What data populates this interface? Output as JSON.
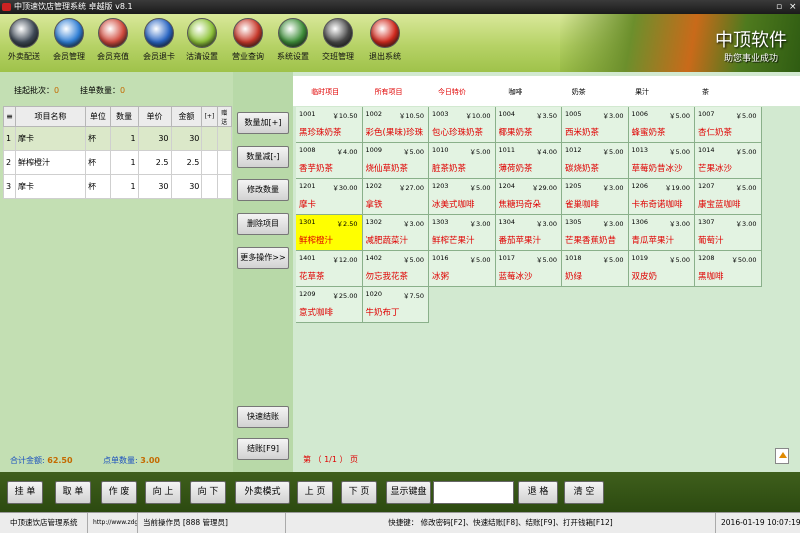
{
  "window": {
    "title": "中顶速饮店管理系统 卓越版 v8.1",
    "controls": [
      "▫",
      "×"
    ]
  },
  "toolbar": {
    "items": [
      {
        "label": "外卖配送",
        "icon": "delivery-icon",
        "color": "#3f4a57"
      },
      {
        "label": "会员管理",
        "icon": "member-icon",
        "color": "#2f7fd6"
      },
      {
        "label": "会员充值",
        "icon": "recharge-icon",
        "color": "#d24b3e"
      },
      {
        "label": "会员退卡",
        "icon": "card-icon",
        "color": "#2a66c4"
      },
      {
        "label": "沽清设置",
        "icon": "dish-icon",
        "color": "#8fc43a"
      },
      {
        "label": "营业查询",
        "icon": "search-icon",
        "color": "#c93a2c"
      },
      {
        "label": "系统设置",
        "icon": "gear-icon",
        "color": "#3f8f3a"
      },
      {
        "label": "交班管理",
        "icon": "shift-icon",
        "color": "#4a4a4a"
      },
      {
        "label": "退出系统",
        "icon": "power-icon",
        "color": "#d22a1e"
      }
    ]
  },
  "brand": {
    "name": "中顶软件",
    "slogan": "助您事业成功"
  },
  "order": {
    "pending_label": "挂起批次：",
    "pending_value": "0",
    "hang_label": "挂单数量：",
    "hang_value": "0",
    "columns": [
      "项目名称",
      "单位",
      "数量",
      "单价",
      "金额",
      "[+]",
      "赠送"
    ],
    "rows": [
      {
        "no": "1",
        "name": "摩卡",
        "unit": "杯",
        "qty": "1",
        "price": "30",
        "amount": "30",
        "selected": true
      },
      {
        "no": "2",
        "name": "鲜榨橙汁",
        "unit": "杯",
        "qty": "1",
        "price": "2.5",
        "amount": "2.5",
        "selected": false
      },
      {
        "no": "3",
        "name": "摩卡",
        "unit": "杯",
        "qty": "1",
        "price": "30",
        "amount": "30",
        "selected": false
      }
    ],
    "total_label": "合计金额:",
    "total_value": "62.50",
    "count_label": "点单数量:",
    "count_value": "3.00"
  },
  "actions": {
    "qty_up": "数量加[+]",
    "qty_down": "数量减[-]",
    "edit_qty": "修改数量",
    "delete_item": "删除项目",
    "more_ops": "更多操作>>",
    "quick_checkout": "快速结账",
    "checkout": "结账[F9]"
  },
  "categories": [
    {
      "label": "临时项目",
      "red": true
    },
    {
      "label": "所有项目",
      "red": true
    },
    {
      "label": "今日特价",
      "red": true
    },
    {
      "label": "咖啡",
      "red": false
    },
    {
      "label": "奶茶",
      "red": false
    },
    {
      "label": "果汁",
      "red": false
    },
    {
      "label": "茶",
      "red": false
    },
    {
      "label": "",
      "red": false
    }
  ],
  "menu_items": [
    {
      "code": "1001",
      "price": "￥10.50",
      "name": "黑珍珠奶茶",
      "hl": false
    },
    {
      "code": "1002",
      "price": "￥10.50",
      "name": "彩色(果味)珍珠",
      "hl": false
    },
    {
      "code": "1003",
      "price": "￥10.00",
      "name": "包心珍珠奶茶",
      "hl": false
    },
    {
      "code": "1004",
      "price": "￥3.50",
      "name": "椰果奶茶",
      "hl": false
    },
    {
      "code": "1005",
      "price": "￥3.00",
      "name": "西米奶茶",
      "hl": false
    },
    {
      "code": "1006",
      "price": "￥5.00",
      "name": "蜂蜜奶茶",
      "hl": false
    },
    {
      "code": "1007",
      "price": "￥5.00",
      "name": "杏仁奶茶",
      "hl": false
    },
    {
      "code": "1008",
      "price": "￥4.00",
      "name": "香芋奶茶",
      "hl": false
    },
    {
      "code": "1009",
      "price": "￥5.00",
      "name": "烧仙草奶茶",
      "hl": false
    },
    {
      "code": "1010",
      "price": "￥5.00",
      "name": "脏茶奶茶",
      "hl": false
    },
    {
      "code": "1011",
      "price": "￥4.00",
      "name": "薄荷奶茶",
      "hl": false
    },
    {
      "code": "1012",
      "price": "￥5.00",
      "name": "碳烧奶茶",
      "hl": false
    },
    {
      "code": "1013",
      "price": "￥5.00",
      "name": "草莓奶昔冰沙",
      "hl": false
    },
    {
      "code": "1014",
      "price": "￥5.00",
      "name": "芒果冰沙",
      "hl": false
    },
    {
      "code": "1201",
      "price": "￥30.00",
      "name": "摩卡",
      "hl": false
    },
    {
      "code": "1202",
      "price": "￥27.00",
      "name": "拿铁",
      "hl": false
    },
    {
      "code": "1203",
      "price": "￥5.00",
      "name": "冰美式咖啡",
      "hl": false
    },
    {
      "code": "1204",
      "price": "￥29.00",
      "name": "焦糖玛奇朵",
      "hl": false
    },
    {
      "code": "1205",
      "price": "￥3.00",
      "name": "雀巢咖啡",
      "hl": false
    },
    {
      "code": "1206",
      "price": "￥19.00",
      "name": "卡布奇诺咖啡",
      "hl": false
    },
    {
      "code": "1207",
      "price": "￥5.00",
      "name": "康宝蓝咖啡",
      "hl": false
    },
    {
      "code": "1301",
      "price": "￥2.50",
      "name": "鲜榨橙汁",
      "hl": true
    },
    {
      "code": "1302",
      "price": "￥3.00",
      "name": "减肥蔬菜汁",
      "hl": false
    },
    {
      "code": "1303",
      "price": "￥3.00",
      "name": "鲜榨芒果汁",
      "hl": false
    },
    {
      "code": "1304",
      "price": "￥3.00",
      "name": "番茄苹果汁",
      "hl": false
    },
    {
      "code": "1305",
      "price": "￥3.00",
      "name": "芒果香蕉奶昔",
      "hl": false
    },
    {
      "code": "1306",
      "price": "￥3.00",
      "name": "青瓜苹果汁",
      "hl": false
    },
    {
      "code": "1307",
      "price": "￥3.00",
      "name": "葡萄汁",
      "hl": false
    },
    {
      "code": "1401",
      "price": "￥12.00",
      "name": "花草茶",
      "hl": false
    },
    {
      "code": "1402",
      "price": "￥5.00",
      "name": "勿忘我花茶",
      "hl": false
    },
    {
      "code": "1016",
      "price": "￥5.00",
      "name": "冰粥",
      "hl": false
    },
    {
      "code": "1017",
      "price": "￥5.00",
      "name": "蓝莓冰沙",
      "hl": false
    },
    {
      "code": "1018",
      "price": "￥5.00",
      "name": "奶绿",
      "hl": false
    },
    {
      "code": "1019",
      "price": "￥5.00",
      "name": "双皮奶",
      "hl": false
    },
    {
      "code": "1208",
      "price": "￥50.00",
      "name": "黑咖啡",
      "hl": false
    },
    {
      "code": "1209",
      "price": "￥25.00",
      "name": "意式咖啡",
      "hl": false
    },
    {
      "code": "1020",
      "price": "￥7.50",
      "name": "牛奶布丁",
      "hl": false
    }
  ],
  "pager": {
    "text": "第 （ 1/1 ） 页"
  },
  "bottom": {
    "hang": "挂 单",
    "take": "取 单",
    "void": "作 废",
    "up": "向 上",
    "down": "向 下",
    "takeout": "外卖模式",
    "prev": "上 页",
    "next": "下 页",
    "keyboard": "显示键盘",
    "back": "退 格",
    "clear": "清 空"
  },
  "status": {
    "system": "中顶速饮店管理系统",
    "url": "http://www.zdgogo.com",
    "operator": "当前操作员 [888 管理员]",
    "shortcuts": "快捷键： 修改密码[F2]、快速结账[F8]、结账[F9]、打开钱箱[F12]",
    "datetime": "2016-01-19 10:07:19"
  }
}
